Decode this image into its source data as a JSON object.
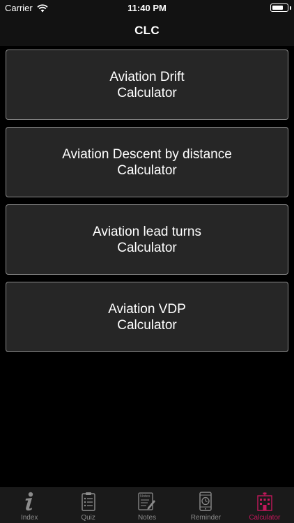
{
  "status_bar": {
    "carrier": "Carrier",
    "time": "11:40 PM"
  },
  "nav": {
    "title": "CLC"
  },
  "buttons": [
    {
      "line1": "Aviation Drift",
      "line2": "Calculator"
    },
    {
      "line1": "Aviation Descent by distance",
      "line2": "Calculator"
    },
    {
      "line1": "Aviation lead turns",
      "line2": "Calculator"
    },
    {
      "line1": "Aviation VDP",
      "line2": "Calculator"
    }
  ],
  "tabs": [
    {
      "label": "Index",
      "icon": "info-icon",
      "active": false
    },
    {
      "label": "Quiz",
      "icon": "clipboard-checklist-icon",
      "active": false
    },
    {
      "label": "Notes",
      "icon": "notes-pen-icon",
      "active": false
    },
    {
      "label": "Reminder",
      "icon": "clock-phone-icon",
      "active": false
    },
    {
      "label": "Calculator",
      "icon": "building-icon",
      "active": true
    }
  ],
  "notes_icon_text": "Notes",
  "colors": {
    "background": "#000000",
    "bar": "#121212",
    "button_fill": "#262626",
    "button_border": "#8a8a8a",
    "tab_inactive": "#8c8c8c",
    "tab_active": "#c2185b"
  }
}
